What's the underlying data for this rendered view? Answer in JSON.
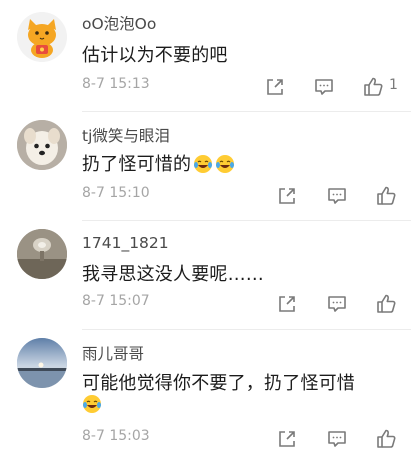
{
  "comments": [
    {
      "username": "oO泡泡Oo",
      "text": "估计以为不要的吧",
      "timestamp": "8-7 15:13",
      "like_count": "1",
      "avatar": "cat-avatar",
      "emojis": []
    },
    {
      "username": "tj微笑与眼泪",
      "text": "扔了怪可惜的",
      "timestamp": "8-7 15:10",
      "like_count": "",
      "avatar": "dog-avatar",
      "emojis": [
        "laugh-cry-emoji",
        "laugh-cry-emoji"
      ]
    },
    {
      "username": "1741_1821",
      "text": "我寻思这没人要呢……",
      "timestamp": "8-7 15:07",
      "like_count": "",
      "avatar": "room-photo-avatar",
      "emojis": []
    },
    {
      "username": "雨儿哥哥",
      "text": "可能他觉得你不要了，扔了怪可惜",
      "timestamp": "8-7 15:03",
      "like_count": "",
      "avatar": "sunset-lake-avatar",
      "emojis": [
        "laugh-cry-emoji"
      ]
    }
  ],
  "icons": {
    "share": "share-icon",
    "reply": "comment-icon",
    "like": "thumbs-up-icon"
  },
  "colors": {
    "username": "#4a4a4a",
    "text": "#1c1c1c",
    "timestamp": "#a5a5a5",
    "icon": "#7a7a7a"
  }
}
